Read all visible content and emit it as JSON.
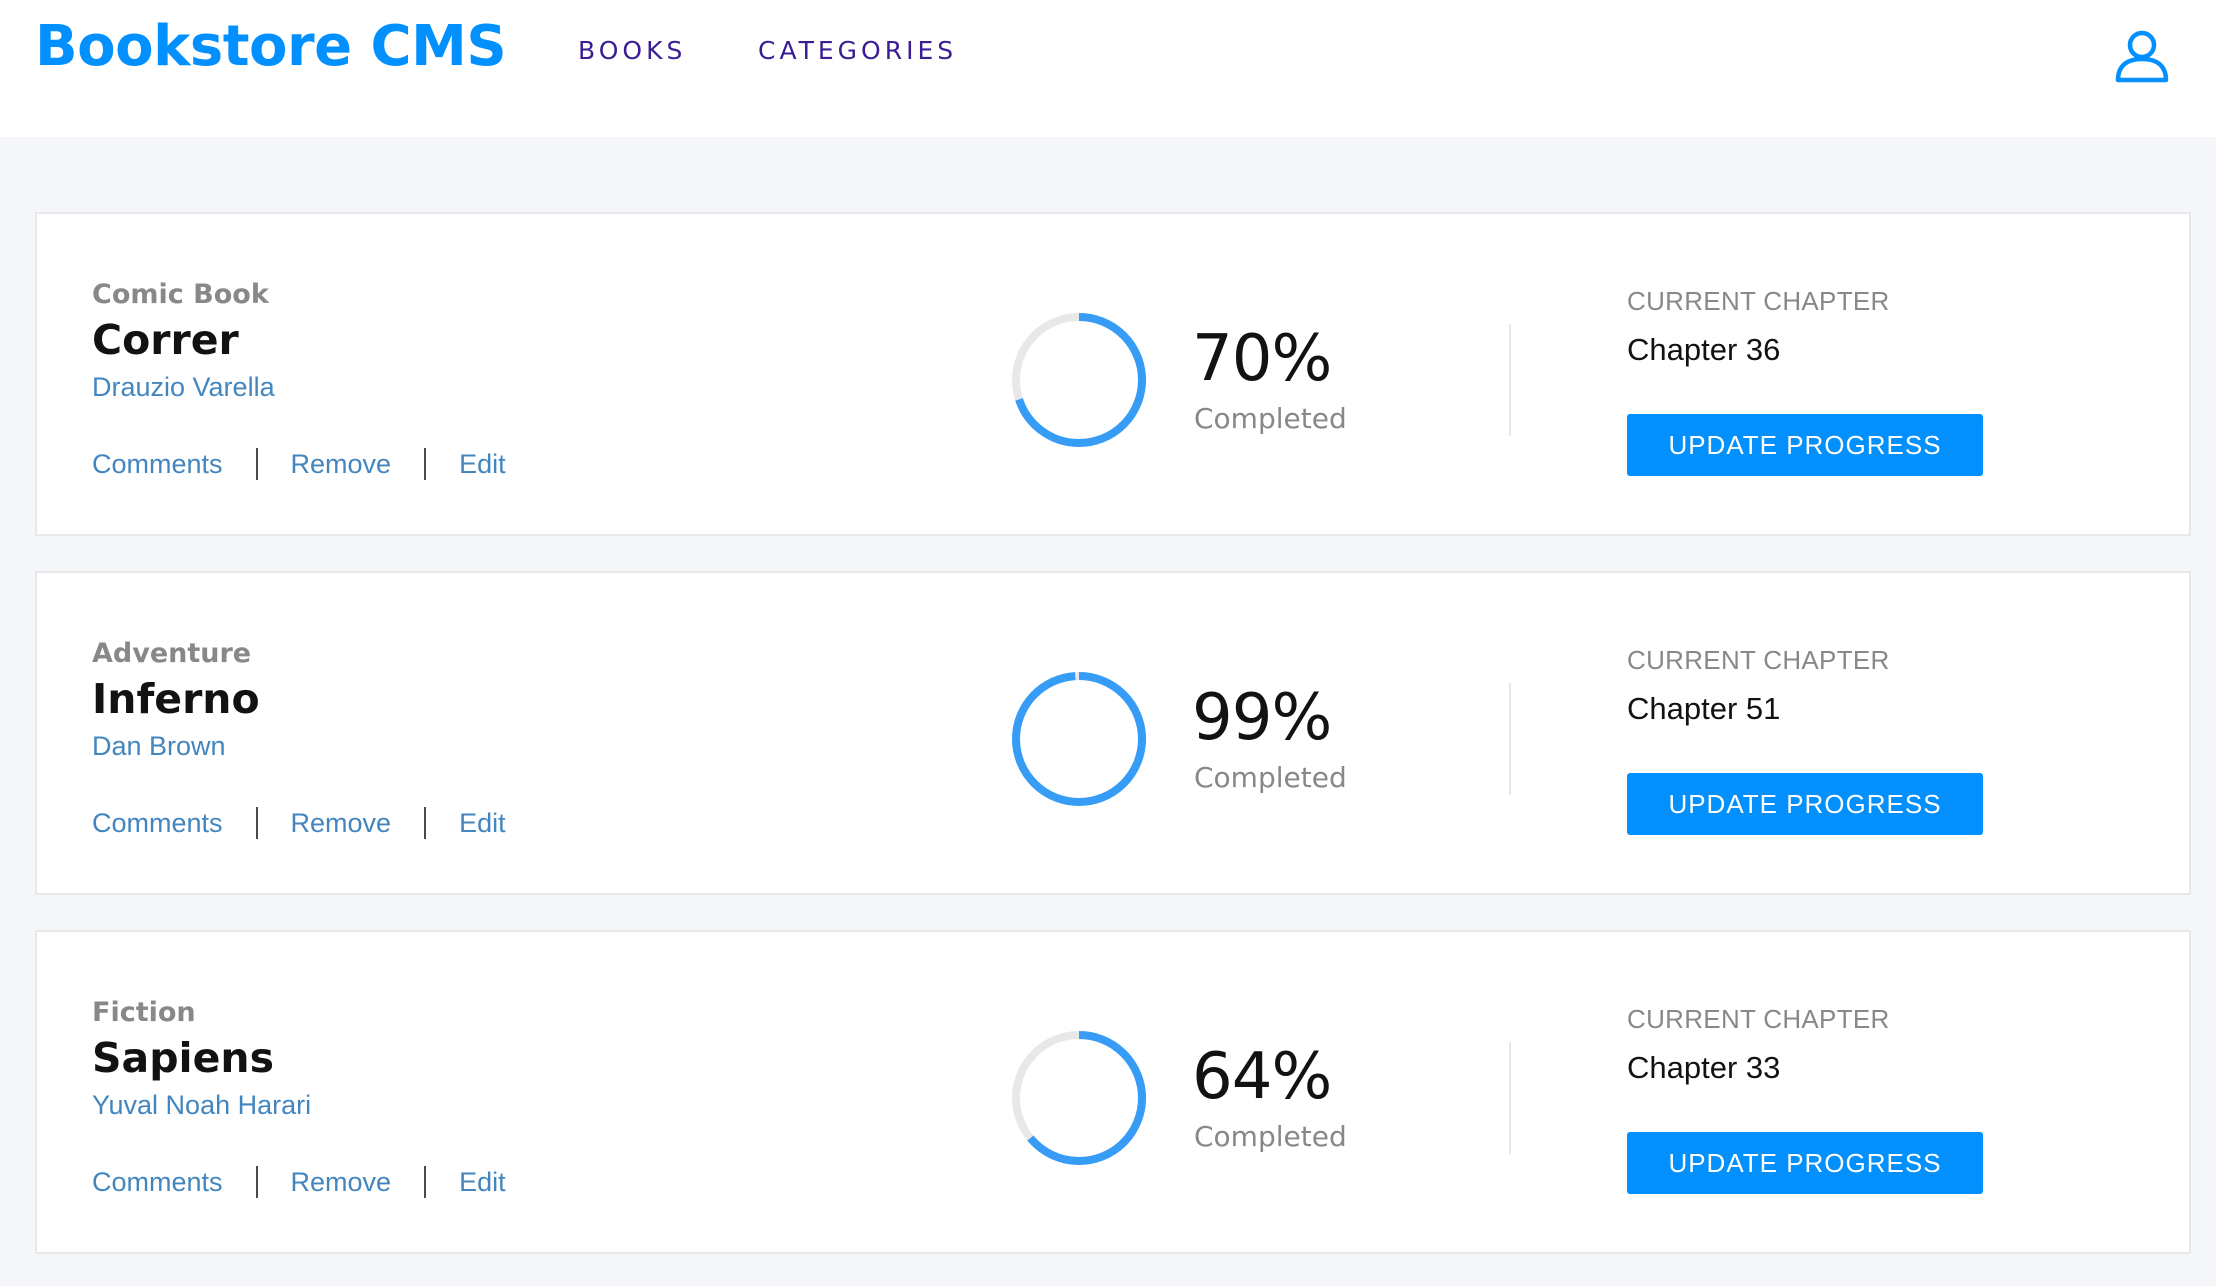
{
  "header": {
    "brand": "Bookstore CMS",
    "nav": [
      {
        "label": "BOOKS"
      },
      {
        "label": "CATEGORIES"
      }
    ],
    "user_icon": "user-icon"
  },
  "colors": {
    "brand": "#0290ff",
    "link": "#4386bf",
    "progress": "#379cf6",
    "progress_track": "#e8e8e8",
    "button": "#0290ff",
    "background": "#f4f6f9"
  },
  "books": [
    {
      "category": "Comic Book",
      "title": "Correr",
      "author": "Drauzio Varella",
      "actions": [
        "Comments",
        "Remove",
        "Edit"
      ],
      "progress": 70,
      "percent_label": "70%",
      "completed_label": "Completed",
      "chapter_label": "CURRENT CHAPTER",
      "chapter": "Chapter 36",
      "button_label": "UPDATE PROGRESS"
    },
    {
      "category": "Adventure",
      "title": "Inferno",
      "author": "Dan Brown",
      "actions": [
        "Comments",
        "Remove",
        "Edit"
      ],
      "progress": 99,
      "percent_label": "99%",
      "completed_label": "Completed",
      "chapter_label": "CURRENT CHAPTER",
      "chapter": "Chapter 51",
      "button_label": "UPDATE PROGRESS"
    },
    {
      "category": "Fiction",
      "title": "Sapiens",
      "author": "Yuval Noah Harari",
      "actions": [
        "Comments",
        "Remove",
        "Edit"
      ],
      "progress": 64,
      "percent_label": "64%",
      "completed_label": "Completed",
      "chapter_label": "CURRENT CHAPTER",
      "chapter": "Chapter 33",
      "button_label": "UPDATE PROGRESS"
    }
  ]
}
